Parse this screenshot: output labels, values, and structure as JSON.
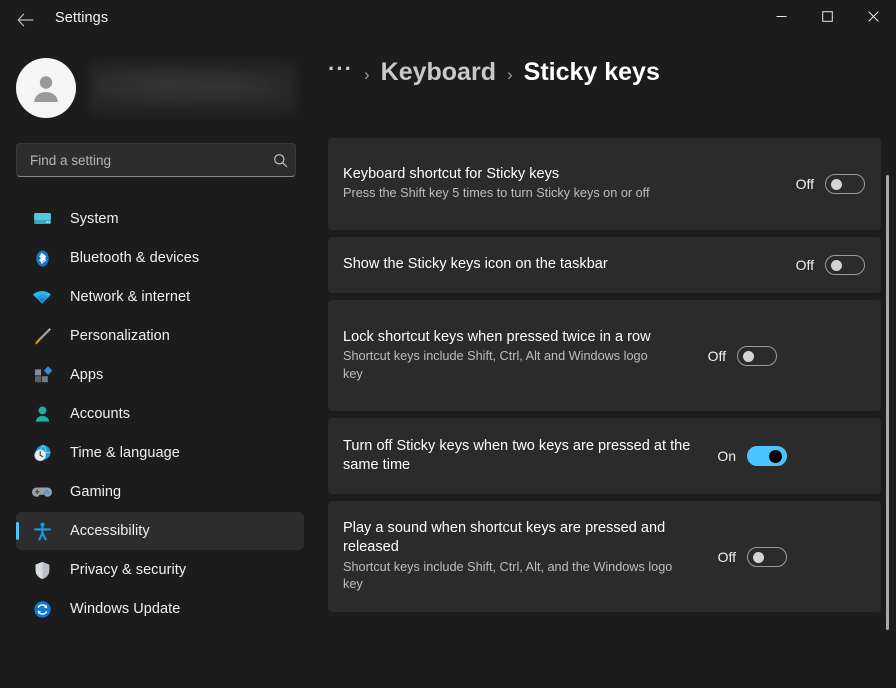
{
  "window": {
    "app_title": "Settings",
    "back_label": "Back",
    "controls": {
      "minimize": "—",
      "maximize": "☐",
      "close": "✕"
    }
  },
  "sidebar": {
    "account": {
      "name_redacted": true
    },
    "search": {
      "placeholder": "Find a setting",
      "value": ""
    },
    "items": [
      {
        "label": "System",
        "icon": "monitor-icon",
        "selected": false
      },
      {
        "label": "Bluetooth & devices",
        "icon": "bluetooth-icon",
        "selected": false
      },
      {
        "label": "Network & internet",
        "icon": "wifi-icon",
        "selected": false
      },
      {
        "label": "Personalization",
        "icon": "paintbrush-icon",
        "selected": false
      },
      {
        "label": "Apps",
        "icon": "apps-icon",
        "selected": false
      },
      {
        "label": "Accounts",
        "icon": "person-icon",
        "selected": false
      },
      {
        "label": "Time & language",
        "icon": "clock-globe-icon",
        "selected": false
      },
      {
        "label": "Gaming",
        "icon": "gamepad-icon",
        "selected": false
      },
      {
        "label": "Accessibility",
        "icon": "accessibility-icon",
        "selected": true
      },
      {
        "label": "Privacy & security",
        "icon": "shield-icon",
        "selected": false
      },
      {
        "label": "Windows Update",
        "icon": "update-icon",
        "selected": false
      }
    ]
  },
  "main": {
    "breadcrumb": {
      "overflow": "···",
      "separator": "›",
      "parent": "Keyboard",
      "current": "Sticky keys"
    },
    "settings": [
      {
        "title": "Keyboard shortcut for Sticky keys",
        "description": "Press the Shift key 5 times to turn Sticky keys on or off",
        "state_label": "Off",
        "state": false
      },
      {
        "title": "Show the Sticky keys icon on the taskbar",
        "description": "",
        "state_label": "Off",
        "state": false
      },
      {
        "title": "Lock shortcut keys when pressed twice in a row",
        "description": "Shortcut keys include Shift, Ctrl, Alt and Windows logo key",
        "state_label": "Off",
        "state": false
      },
      {
        "title": "Turn off Sticky keys when two keys are pressed at the same time",
        "description": "",
        "state_label": "On",
        "state": true
      },
      {
        "title": "Play a sound when shortcut keys are pressed and released",
        "description": "Shortcut keys include Shift, Ctrl, Alt, and the Windows logo key",
        "state_label": "Off",
        "state": false
      }
    ]
  },
  "colors": {
    "accent": "#4cc2ff",
    "page_bg": "#1c1c1c",
    "card_bg": "#2b2b2b"
  }
}
